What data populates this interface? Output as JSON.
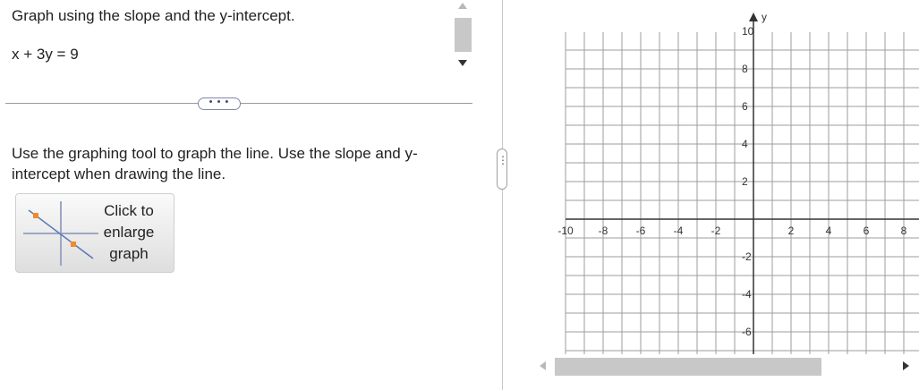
{
  "question": {
    "title": "Graph using the slope and the y-intercept.",
    "equation": "x + 3y = 9"
  },
  "more_button": {
    "label": "• • •"
  },
  "instructions": "Use the graphing tool to graph the line. Use the slope and y-intercept when drawing the line.",
  "enlarge_button": {
    "label": "Click to enlarge graph",
    "icon": "graph-line-icon"
  },
  "divider_handle": {
    "label": "⋮"
  },
  "graph": {
    "y_axis_label": "y",
    "x_range": [
      -10,
      8
    ],
    "y_range": [
      -6,
      10
    ],
    "grid": true,
    "x_tick_labels": [
      "-10",
      "-8",
      "-6",
      "-4",
      "-2",
      "2",
      "4",
      "6",
      "8"
    ],
    "y_tick_labels": [
      "10",
      "8",
      "6",
      "4",
      "2",
      "-2",
      "-4",
      "-6"
    ]
  },
  "colors": {
    "accent_point": "#f08a2a",
    "grid": "#9e9e9e",
    "axis": "#333333"
  }
}
